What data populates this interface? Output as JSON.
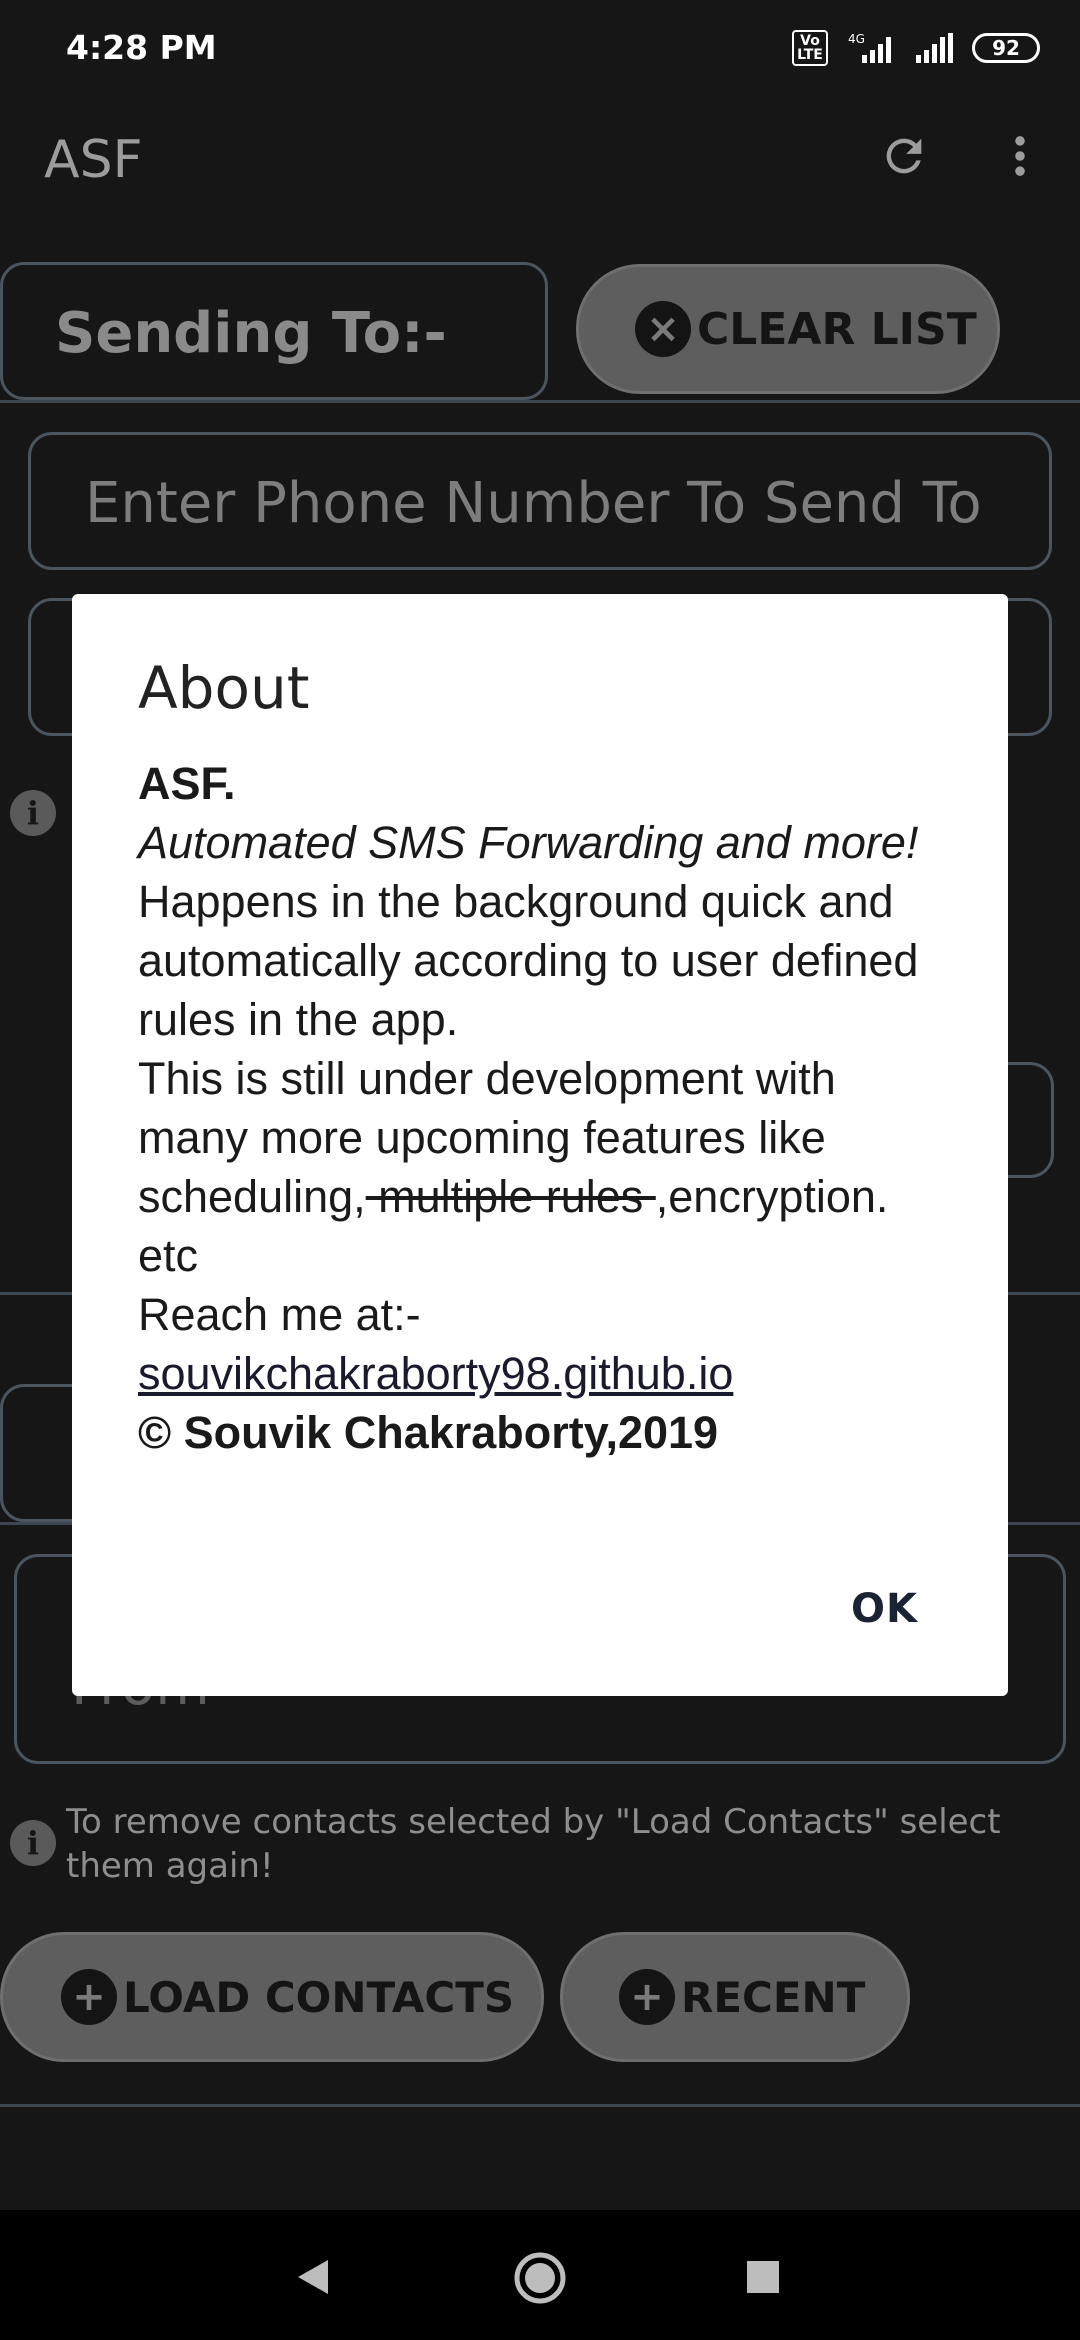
{
  "status_bar": {
    "time": "4:28 PM",
    "volte": "Vo LTE",
    "network": "4G",
    "battery": "92"
  },
  "app_bar": {
    "title": "ASF",
    "refresh_icon": "refresh-icon",
    "menu_icon": "more-vert-icon"
  },
  "sending_section": {
    "label": "Sending To:-",
    "clear_button": "CLEAR LIST",
    "phone_placeholder": "Enter Phone Number To Send To"
  },
  "from_section": {
    "field_partial": "From",
    "info_text": "To remove contacts selected by \"Load Contacts\" select them again!",
    "load_contacts_button": "LOAD CONTACTS",
    "recent_button": "RECENT"
  },
  "dialog": {
    "title": "About",
    "app_name": "ASF.",
    "tagline": "Automated SMS Forwarding and more!",
    "description": "Happens in the background quick and automatically according to user defined rules in the app.",
    "development_note": "This is still under development with many more upcoming features like scheduling,",
    "struck_text": " multiple rules ",
    "after_strike": ",encryption. etc",
    "reach_label": "Reach me at:-",
    "link": "souvikchakraborty98.github.io",
    "copyright": " © Souvik Chakraborty,2019",
    "ok_button": "OK"
  },
  "colors": {
    "background": "#161616",
    "dialog": "#ffffff",
    "pill": "#5e5e5e",
    "outline": "#4a5560"
  }
}
